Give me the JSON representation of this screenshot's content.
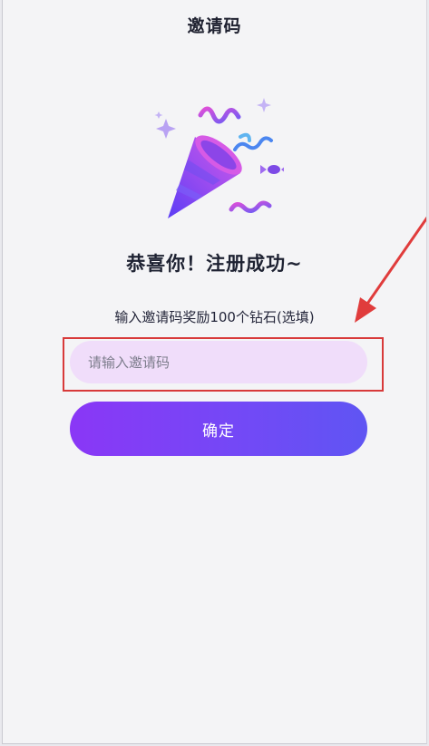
{
  "header": {
    "title": "邀请码"
  },
  "main": {
    "headline": "恭喜你！注册成功~",
    "subtitle": "输入邀请码奖励100个钻石(选填)",
    "invite_input": {
      "value": "",
      "placeholder": "请输入邀请码"
    },
    "confirm_label": "确定"
  },
  "icons": {
    "celebration": "party-popper-icon",
    "annotation": "red-arrow-pointer"
  },
  "colors": {
    "accent_start": "#8a37f6",
    "accent_end": "#5f55f3",
    "input_bg": "#f0ddfa",
    "highlight": "#d83a3a",
    "page_bg": "#f4f4f6"
  }
}
